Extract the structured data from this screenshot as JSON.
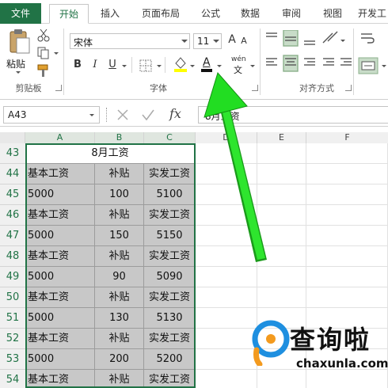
{
  "ribbon_tabs": [
    "文件",
    "开始",
    "插入",
    "页面布局",
    "公式",
    "数据",
    "审阅",
    "视图",
    "开发工"
  ],
  "active_tab": "开始",
  "clipboard": {
    "paste_label": "粘贴",
    "group_label": "剪贴板"
  },
  "font_group": {
    "font_name": "宋体",
    "font_size": "11",
    "bold": "B",
    "italic": "I",
    "underline": "U",
    "font_color_glyph": "A",
    "phonetic_top": "wén",
    "phonetic_bottom": "文",
    "grow_font": "A",
    "shrink_font": "A",
    "group_label": "字体"
  },
  "alignment_group": {
    "group_label": "对齐方式"
  },
  "formula_bar": {
    "name_box": "A43",
    "fx_label": "fx",
    "content": "8月工资"
  },
  "columns": [
    "A",
    "B",
    "C",
    "D",
    "E",
    "F"
  ],
  "rows": [
    {
      "num": "43",
      "cells": [
        "8月工资"
      ]
    },
    {
      "num": "44",
      "cells": [
        "基本工资",
        "补贴",
        "实发工资"
      ]
    },
    {
      "num": "45",
      "cells": [
        "5000",
        "100",
        "5100"
      ]
    },
    {
      "num": "46",
      "cells": [
        "基本工资",
        "补贴",
        "实发工资"
      ]
    },
    {
      "num": "47",
      "cells": [
        "5000",
        "150",
        "5150"
      ]
    },
    {
      "num": "48",
      "cells": [
        "基本工资",
        "补贴",
        "实发工资"
      ]
    },
    {
      "num": "49",
      "cells": [
        "5000",
        "90",
        "5090"
      ]
    },
    {
      "num": "50",
      "cells": [
        "基本工资",
        "补贴",
        "实发工资"
      ]
    },
    {
      "num": "51",
      "cells": [
        "5000",
        "130",
        "5130"
      ]
    },
    {
      "num": "52",
      "cells": [
        "基本工资",
        "补贴",
        "实发工资"
      ]
    },
    {
      "num": "53",
      "cells": [
        "5000",
        "200",
        "5200"
      ]
    },
    {
      "num": "54",
      "cells": [
        "基本工资",
        "补贴",
        "实发工资"
      ]
    }
  ],
  "watermark": {
    "brand": "查询啦",
    "url": "chaxunla.com"
  },
  "colors": {
    "excel_green": "#217346",
    "arrow_green": "#22dd22",
    "cell_grey": "#c8c8c8",
    "highlight_yellow": "#ffff00"
  },
  "icons": [
    "paste-icon",
    "cut-icon",
    "copy-icon",
    "format-painter-icon",
    "border-icon",
    "fill-color-icon",
    "font-color-icon",
    "phonetic-icon",
    "align-icons",
    "wrap-text-icon",
    "merge-center-icon",
    "cancel-icon",
    "enter-icon",
    "annotation-arrow"
  ]
}
